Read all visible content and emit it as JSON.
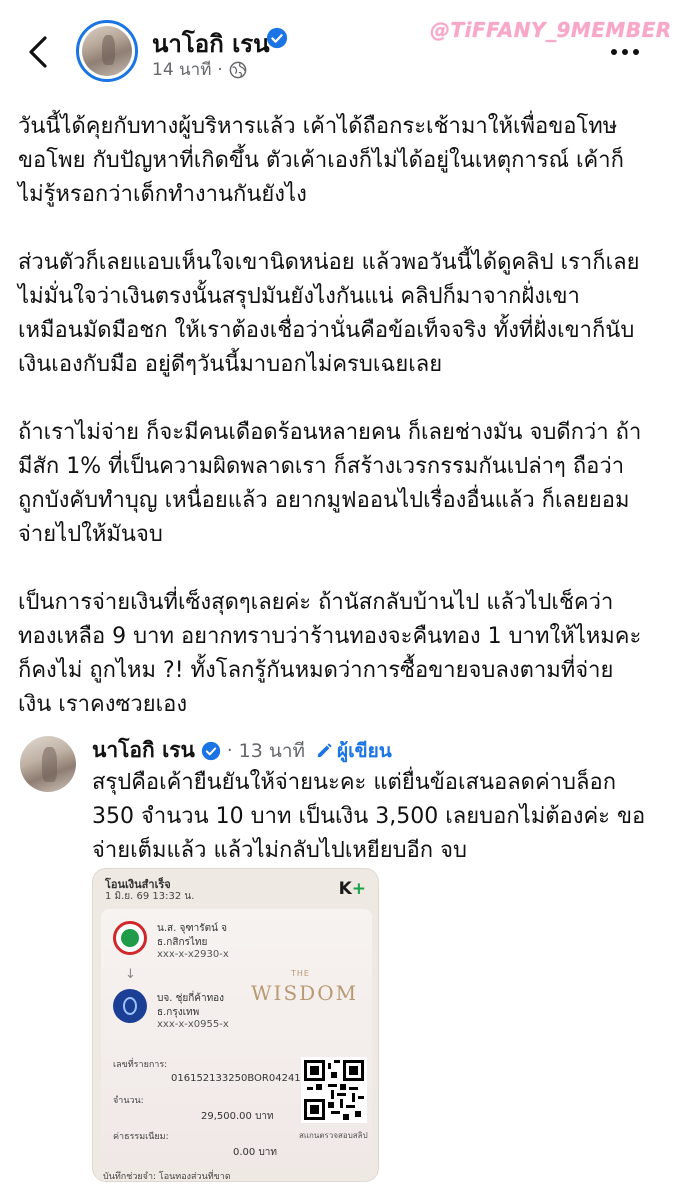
{
  "header": {
    "author_name": "นาโอกิ เรน",
    "timestamp": "14 นาที",
    "separator": "·",
    "watermark": "@TiFFANY_9MEMBER"
  },
  "post": {
    "paragraphs": [
      "วันนี้ได้คุยกับทางผู้บริหารแล้ว เค้าได้ถือกระเช้ามาให้เพื่อขอโทษ\nขอโพย กับปัญหาที่เกิดขึ้น ตัวเค้าเองก็ไม่ได้อยู่ในเหตุการณ์ เค้าก็\nไม่รู้หรอกว่าเด็กทำงานกันยังไง",
      "ส่วนตัวก็เลยแอบเห็นใจเขานิดหน่อย แล้วพอวันนี้ได้ดูคลิป เราก็เลย\nไม่มั่นใจว่าเงินตรงนั้นสรุปมันยังไงกันแน่ คลิปก็มาจากฝั่งเขา\nเหมือนมัดมือชก ให้เราต้องเชื่อว่านั่นคือข้อเท็จจริง ทั้งที่ฝั่งเขาก็นับ\nเงินเองกับมือ อยู่ดีๆวันนี้มาบอกไม่ครบเฉยเลย",
      "ถ้าเราไม่จ่าย ก็จะมีคนเดือดร้อนหลายคน ก็เลยช่างมัน จบดีกว่า ถ้า\nมีสัก 1% ที่เป็นความผิดพลาดเรา ก็สร้างเวรกรรมกันเปล่าๆ ถือว่า\nถูกบังคับทำบุญ เหนื่อยแล้ว อยากมูฟออนไปเรื่องอื่นแล้ว ก็เลยยอม\nจ่ายไปให้มันจบ",
      "เป็นการจ่ายเงินที่เซ็งสุดๆเลยค่ะ ถ้านัสกลับบ้านไป แล้วไปเช็คว่า\nทองเหลือ 9 บาท อยากทราบว่าร้านทองจะคืนทอง 1 บาทให้ไหมคะ\nก็คงไม่ ถูกไหม ?! ทั้งโลกรู้กันหมดว่าการซื้อขายจบลงตามที่จ่าย\nเงิน เราคงซวยเอง"
    ]
  },
  "comment": {
    "author_name": "นาโอกิ เรน",
    "separator": "·",
    "timestamp": "13 นาที",
    "author_badge": "ผู้เขียน",
    "text": "สรุปคือเค้ายืนยันให้จ่ายนะคะ แต่ยื่นข้อเสนอลดค่าบล็อก\n350 จำนวน 10 บาท เป็นเงิน 3,500 เลยบอกไม่ต้องค่ะ ขอ\nจ่ายเต็มแล้ว แล้วไม่กลับไปเหยียบอีก จบ"
  },
  "slip": {
    "title": "โอนเงินสำเร็จ",
    "date": "1 มิ.ย. 69  13:32 น.",
    "app_logo": "K",
    "app_logo_plus": "+",
    "from_name": "น.ส. จุฑารัตน์ จ",
    "from_bank": "ธ.กสิกรไทย",
    "from_account": "xxx-x-x2930-x",
    "arrow": "↓",
    "to_name": "บจ. ชุ่ยกี่ค้าทอง",
    "to_bank": "ธ.กรุงเทพ",
    "to_account": "xxx-x-x0955-x",
    "watermark_small": "THE",
    "watermark": "WISDOM",
    "ref_label": "เลขที่รายการ:",
    "ref_value": "016152133250BOR04241",
    "amount_label": "จำนวน:",
    "amount_value": "29,500.00 บาท",
    "fee_label": "ค่าธรรมเนียม:",
    "fee_value": "0.00 บาท",
    "qr_caption": "สแกนตรวจสอบสลิป",
    "note": "บันทึกช่วยจำ: โอนทองส่วนที่ขาด"
  },
  "colors": {
    "accent": "#1b74e4",
    "secondary_text": "#65676b",
    "watermark_pink": "#f7a8c8",
    "kbank_green": "#1f9b4a",
    "bbl_blue": "#1b3f94"
  },
  "icons": [
    "back-arrow-icon",
    "verified-badge-icon",
    "globe-icon",
    "more-options-icon",
    "pencil-icon",
    "arrow-down-icon"
  ]
}
